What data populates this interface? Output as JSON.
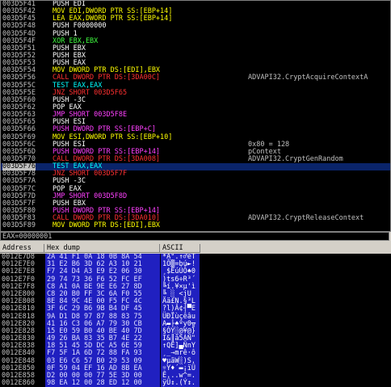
{
  "disasm": [
    {
      "addr": "003D5F41",
      "ins": "PUSH EDI",
      "cls": "white",
      "cmt": ""
    },
    {
      "addr": "003D5F42",
      "ins": "MOV EDI,DWORD PTR SS:[EBP+14]",
      "cls": "yellow",
      "cmt": ""
    },
    {
      "addr": "003D5F45",
      "ins": "LEA EAX,DWORD PTR SS:[EBP+14]",
      "cls": "yellow",
      "cmt": ""
    },
    {
      "addr": "003D5F48",
      "ins": "PUSH F0000000",
      "cls": "white",
      "cmt": ""
    },
    {
      "addr": "003D5F4D",
      "ins": "PUSH 1",
      "cls": "white",
      "cmt": ""
    },
    {
      "addr": "003D5F4F",
      "ins": "XOR EBX,EBX",
      "cls": "green",
      "cmt": ""
    },
    {
      "addr": "003D5F51",
      "ins": "PUSH EBX",
      "cls": "white",
      "cmt": ""
    },
    {
      "addr": "003D5F52",
      "ins": "PUSH EBX",
      "cls": "white",
      "cmt": ""
    },
    {
      "addr": "003D5F53",
      "ins": "PUSH EAX",
      "cls": "white",
      "cmt": ""
    },
    {
      "addr": "003D5F54",
      "ins": "MOV DWORD PTR DS:[EDI],EBX",
      "cls": "yellow",
      "cmt": ""
    },
    {
      "addr": "003D5F56",
      "ins": "CALL DWORD PTR DS:[3DA00C]",
      "cls": "red",
      "cmt": "ADVAPI32.CryptAcquireContextA"
    },
    {
      "addr": "003D5F5C",
      "ins": "TEST EAX,EAX",
      "cls": "cyan",
      "cmt": ""
    },
    {
      "addr": "003D5F5E",
      "ins": "JNZ SHORT 003D5F65",
      "cls": "red",
      "cmt": ""
    },
    {
      "addr": "003D5F60",
      "ins": "PUSH -3C",
      "cls": "white",
      "cmt": ""
    },
    {
      "addr": "003D5F62",
      "ins": "POP EAX",
      "cls": "white",
      "cmt": ""
    },
    {
      "addr": "003D5F63",
      "ins": "JMP SHORT 003D5F8E",
      "cls": "magenta",
      "cmt": ""
    },
    {
      "addr": "003D5F65",
      "ins": "PUSH ESI",
      "cls": "white",
      "cmt": ""
    },
    {
      "addr": "003D5F66",
      "ins": "PUSH DWORD PTR SS:[EBP+C]",
      "cls": "magenta",
      "cmt": ""
    },
    {
      "addr": "003D5F69",
      "ins": "MOV ESI,DWORD PTR SS:[EBP+10]",
      "cls": "yellow",
      "cmt": ""
    },
    {
      "addr": "003D5F6C",
      "ins": "PUSH ESI",
      "cls": "white",
      "cmt": "0x80 = 128"
    },
    {
      "addr": "003D5F6D",
      "ins": "PUSH DWORD PTR SS:[EBP+14]",
      "cls": "magenta",
      "cmt": "pContext"
    },
    {
      "addr": "003D5F70",
      "ins": "CALL DWORD PTR DS:[3DA008]",
      "cls": "red",
      "cmt": "ADVAPI32.CryptGenRandom"
    },
    {
      "addr": "003D5F76",
      "ins": "TEST EAX,EAX",
      "cls": "cyan",
      "cmt": ""
    },
    {
      "addr": "003D5F78",
      "ins": "JNZ SHORT 003D5F7F",
      "cls": "red",
      "cmt": ""
    },
    {
      "addr": "003D5F7A",
      "ins": "PUSH -3C",
      "cls": "white",
      "cmt": ""
    },
    {
      "addr": "003D5F7C",
      "ins": "POP EAX",
      "cls": "white",
      "cmt": ""
    },
    {
      "addr": "003D5F7D",
      "ins": "JMP SHORT 003D5F8D",
      "cls": "magenta",
      "cmt": ""
    },
    {
      "addr": "003D5F7F",
      "ins": "PUSH EBX",
      "cls": "white",
      "cmt": ""
    },
    {
      "addr": "003D5F80",
      "ins": "PUSH DWORD PTR SS:[EBP+14]",
      "cls": "magenta",
      "cmt": ""
    },
    {
      "addr": "003D5F83",
      "ins": "CALL DWORD PTR DS:[3DA010]",
      "cls": "red",
      "cmt": "ADVAPI32.CryptReleaseContext"
    },
    {
      "addr": "003D5F89",
      "ins": "MOV DWORD PTR DS:[EDI],EBX",
      "cls": "yellow",
      "cmt": ""
    }
  ],
  "selected_row_index": 22,
  "status": "EAX=00000001",
  "dump_headers": {
    "address": "Address",
    "hex": "Hex dump",
    "ascii": "ASCII"
  },
  "dump": [
    {
      "addr": "0012E7D8",
      "hex": "2A 41 F1 0A 18 0B 8A 54",
      "asc": "*A°.↑♂èT"
    },
    {
      "addr": "0012E7E0",
      "hex": "31 E2 B6 3D 62 A3 10 21",
      "asc": "1Ô▒=bú►!"
    },
    {
      "addr": "0012E7E8",
      "hex": "F7 24 D4 A3 E9 E2 06 30",
      "asc": "¸$ÈúÚÔ♠0"
    },
    {
      "addr": "0012E7F0",
      "hex": "29 74 73 36 F6 52 FC EF",
      "asc": ")ts6÷R³´"
    },
    {
      "addr": "0012E7F8",
      "hex": "C8 A1 0A BE 9E E6 27 8D",
      "asc": "╚í.¥×µ'ì"
    },
    {
      "addr": "0012E800",
      "hex": "C8 20 B0 FF 3C 6A F0 55",
      "asc": "╚ ░ <j­U"
    },
    {
      "addr": "0012E808",
      "hex": "8E 84 9C 4E 00 F5 FC 4C",
      "asc": "Ää£N.§³L"
    },
    {
      "addr": "0012E810",
      "hex": "3F 6C 29 B6 9B B4 DF 45",
      "asc": "?l)Â¢┤▀E"
    },
    {
      "addr": "0012E818",
      "hex": "9A D1 D8 97 87 88 83 75",
      "asc": "ÜÐÏùçêâu"
    },
    {
      "addr": "0012E820",
      "hex": "41 16 C3 06 A7 79 30 CB",
      "asc": "A▬├♠ºy0╦"
    },
    {
      "addr": "0012E828",
      "hex": "15 E0 59 B0 40 BE 40 7D",
      "asc": "§ÓY░@¥@}"
    },
    {
      "addr": "0012E830",
      "hex": "49 26 BA 83 35 B7 4E 22",
      "asc": "I&║â5ÀN\""
    },
    {
      "addr": "0012E838",
      "hex": "18 51 45 5D DC A5 6E 59",
      "asc": "↑QE]▄ÑnY"
    },
    {
      "addr": "0012E840",
      "hex": "F7 5F 1A 6D 72 88 FA 93",
      "asc": "¸_→mrê·ô"
    },
    {
      "addr": "0012E848",
      "hex": "03 E6 C6 57 B0 29 53 09",
      "asc": "♥µãW░)S."
    },
    {
      "addr": "0012E850",
      "hex": "0F 59 04 EF 16 AD 8B EA",
      "asc": "☼Y♦´▬¡ïÛ"
    },
    {
      "addr": "0012E858",
      "hex": "D2 00 00 00 77 5E 3D 00",
      "asc": "Ê...w^=."
    },
    {
      "addr": "0012E860",
      "hex": "98 EA 12 00 28 ED 12 00",
      "asc": "ÿÛ↕.(Ý↕."
    }
  ]
}
